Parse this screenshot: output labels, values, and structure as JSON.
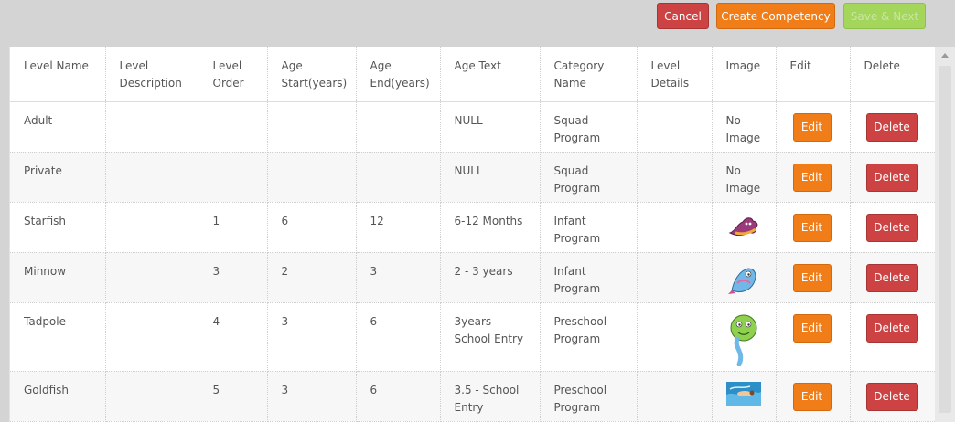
{
  "toolbar": {
    "cancel_label": "Cancel",
    "create_label": "Create Competency",
    "save_label": "Save & Next"
  },
  "table": {
    "headers": {
      "level_name": "Level Name",
      "level_description_1": "Level",
      "level_description_2": "Description",
      "level_order_1": "Level",
      "level_order_2": "Order",
      "age_start_1": "Age",
      "age_start_2": "Start(years)",
      "age_end_1": "Age",
      "age_end_2": "End(years)",
      "age_text": "Age Text",
      "category_1": "Category",
      "category_2": "Name",
      "level_details_1": "Level",
      "level_details_2": "Details",
      "image": "Image",
      "edit": "Edit",
      "delete": "Delete"
    },
    "rows": [
      {
        "name": "Adult",
        "description": "",
        "order": "",
        "age_start": "",
        "age_end": "",
        "age_text_1": "NULL",
        "age_text_2": "",
        "category_1": "Squad",
        "category_2": "Program",
        "details": "",
        "image_text_1": "No",
        "image_text_2": "Image",
        "image_icon": "",
        "edit": "Edit",
        "delete": "Delete"
      },
      {
        "name": "Private",
        "description": "",
        "order": "",
        "age_start": "",
        "age_end": "",
        "age_text_1": "NULL",
        "age_text_2": "",
        "category_1": "Squad",
        "category_2": "Program",
        "details": "",
        "image_text_1": "No",
        "image_text_2": "Image",
        "image_icon": "",
        "edit": "Edit",
        "delete": "Delete"
      },
      {
        "name": "Starfish",
        "description": "",
        "order": "1",
        "age_start": "6",
        "age_end": "12",
        "age_text_1": "6-12 Months",
        "age_text_2": "",
        "category_1": "Infant",
        "category_2": "Program",
        "details": "",
        "image_text_1": "",
        "image_text_2": "",
        "image_icon": "starfish-icon",
        "edit": "Edit",
        "delete": "Delete"
      },
      {
        "name": "Minnow",
        "description": "",
        "order": "3",
        "age_start": "2",
        "age_end": "3",
        "age_text_1": "2 - 3 years",
        "age_text_2": "",
        "category_1": "Infant",
        "category_2": "Program",
        "details": "",
        "image_text_1": "",
        "image_text_2": "",
        "image_icon": "minnow-icon",
        "edit": "Edit",
        "delete": "Delete"
      },
      {
        "name": "Tadpole",
        "description": "",
        "order": "4",
        "age_start": "3",
        "age_end": "6",
        "age_text_1": "3years -",
        "age_text_2": "School Entry",
        "category_1": "Preschool",
        "category_2": "Program",
        "details": "",
        "image_text_1": "",
        "image_text_2": "",
        "image_icon": "tadpole-icon",
        "edit": "Edit",
        "delete": "Delete"
      },
      {
        "name": "Goldfish",
        "description": "",
        "order": "5",
        "age_start": "3",
        "age_end": "6",
        "age_text_1": "3.5 - School",
        "age_text_2": "Entry",
        "category_1": "Preschool",
        "category_2": "Program",
        "details": "",
        "image_text_1": "",
        "image_text_2": "",
        "image_icon": "goldfish-photo-icon",
        "edit": "Edit",
        "delete": "Delete"
      }
    ]
  },
  "colors": {
    "cancel": "#cd4242",
    "create": "#f07d18",
    "save": "#a4d65b"
  }
}
